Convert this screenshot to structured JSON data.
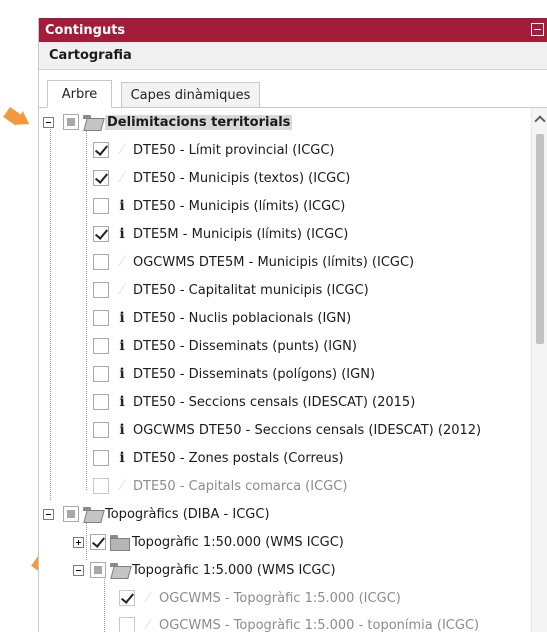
{
  "panel": {
    "title": "Continguts",
    "section": "Cartografia"
  },
  "tabs": [
    {
      "label": "Arbre",
      "active": true
    },
    {
      "label": "Capes dinàmiques",
      "active": false
    }
  ],
  "tree": {
    "group1": {
      "label": "Delimitacions territorials",
      "items": [
        {
          "label": "DTE50 - Límit provincial (ICGC)",
          "checked": true,
          "info": false
        },
        {
          "label": "DTE50 - Municipis (textos) (ICGC)",
          "checked": true,
          "info": false
        },
        {
          "label": "DTE50 - Municipis (límits) (ICGC)",
          "checked": false,
          "info": true
        },
        {
          "label": "DTE5M - Municipis (límits) (ICGC)",
          "checked": true,
          "info": true
        },
        {
          "label": "OGCWMS DTE5M - Municipis (límits) (ICGC)",
          "checked": false,
          "info": false
        },
        {
          "label": "DTE50 - Capitalitat municipis (ICGC)",
          "checked": false,
          "info": false
        },
        {
          "label": "DTE50 - Nuclis poblacionals (IGN)",
          "checked": false,
          "info": true
        },
        {
          "label": "DTE50 - Disseminats (punts) (IGN)",
          "checked": false,
          "info": true
        },
        {
          "label": "DTE50 - Disseminats (polígons) (IGN)",
          "checked": false,
          "info": true
        },
        {
          "label": "DTE50 - Seccions censals (IDESCAT) (2015)",
          "checked": false,
          "info": true
        },
        {
          "label": "OGCWMS DTE50 - Seccions censals (IDESCAT) (2012)",
          "checked": false,
          "info": true
        },
        {
          "label": "DTE50 - Zones postals (Correus)",
          "checked": false,
          "info": true
        },
        {
          "label": "DTE50 - Capitals comarca (ICGC)",
          "checked": false,
          "info": false,
          "disabled": true
        }
      ]
    },
    "group2": {
      "label": "Topogràfics (DIBA - ICGC)",
      "sub1": {
        "label": "Topogràfic 1:50.000 (WMS ICGC)",
        "checked": true
      },
      "sub2": {
        "label": "Topogràfic 1:5.000 (WMS ICGC)",
        "items": [
          {
            "label": "OGCWMS - Topogràfic 1:5.000 (ICGC)",
            "checked": true,
            "disabled": true
          },
          {
            "label": "OGCWMS - Topogràfic 1:5.000 - toponímia (ICGC)",
            "checked": false,
            "disabled": true
          }
        ]
      }
    }
  },
  "colors": {
    "titlebar": "#a31c39",
    "arrow": "#f29a3c"
  },
  "icons": [
    "collapse-icon",
    "expand-toggle-icon",
    "folder-icon",
    "info-icon",
    "checkbox-icon",
    "arrow-pointer-icon",
    "scroll-up-icon"
  ]
}
